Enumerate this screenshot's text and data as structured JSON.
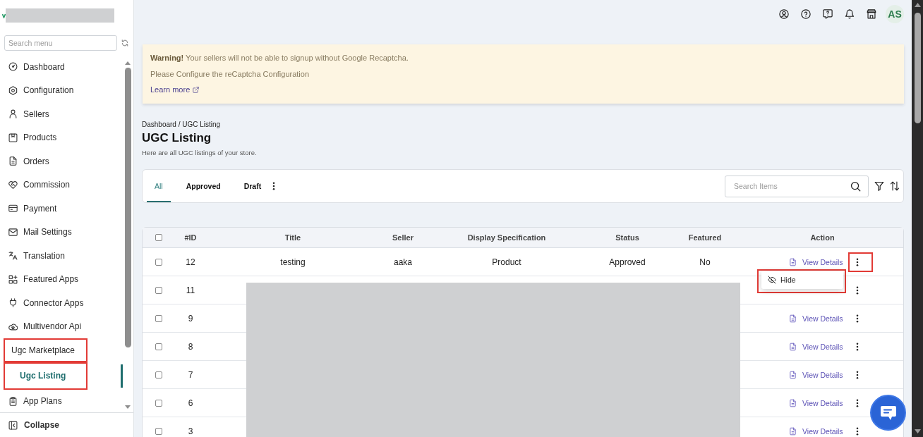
{
  "sidebar": {
    "search": {
      "placeholder": "Search menu"
    },
    "items": [
      {
        "label": "Dashboard",
        "selected": false,
        "highlighted": false
      },
      {
        "label": "Configuration",
        "selected": false,
        "highlighted": false
      },
      {
        "label": "Sellers",
        "selected": false,
        "highlighted": false
      },
      {
        "label": "Products",
        "selected": false,
        "highlighted": false
      },
      {
        "label": "Orders",
        "selected": false,
        "highlighted": false
      },
      {
        "label": "Commission",
        "selected": false,
        "highlighted": false
      },
      {
        "label": "Payment",
        "selected": false,
        "highlighted": false
      },
      {
        "label": "Mail Settings",
        "selected": false,
        "highlighted": false
      },
      {
        "label": "Translation",
        "selected": false,
        "highlighted": false
      },
      {
        "label": "Featured Apps",
        "selected": false,
        "highlighted": false
      },
      {
        "label": "Connector Apps",
        "selected": false,
        "highlighted": false
      },
      {
        "label": "Multivendor Api",
        "selected": false,
        "highlighted": false
      },
      {
        "label": "Ugc Marketplace",
        "selected": false,
        "highlighted": true,
        "children": [
          {
            "label": "Ugc Listing",
            "selected": true,
            "highlighted": true
          }
        ]
      },
      {
        "label": "App Plans",
        "selected": false,
        "highlighted": false
      }
    ],
    "collapse": {
      "label": "Collapse"
    }
  },
  "header": {
    "avatar": {
      "initials": "AS"
    }
  },
  "warning": {
    "message": "**Warning!** Your sellers will not be able to signup without Google Recaptcha.",
    "detail": "Please Configure the reCaptcha Configuration",
    "link": "Learn more"
  },
  "breadcrumb": "Dashboard / UGC Listing",
  "page": {
    "title": "UGC Listing",
    "subtitle": "Here are all UGC listings of your store."
  },
  "tabs": [
    {
      "label": "All",
      "selected": true
    },
    {
      "label": "Approved",
      "selected": false
    },
    {
      "label": "Draft",
      "selected": false
    }
  ],
  "search": {
    "placeholder": "Search Items"
  },
  "table": {
    "header_checked": false,
    "columns": [
      "#ID",
      "Title",
      "Seller",
      "Display Specification",
      "Status",
      "Featured",
      "Action"
    ],
    "rows": [
      {
        "checked": false,
        "id": "12",
        "title": "testing",
        "seller": "aaka",
        "display_specification": "Product",
        "status": "Approved",
        "featured": "No",
        "action": "View Details",
        "highlighted": true
      },
      {
        "checked": false,
        "id": "11",
        "highlighted": false
      },
      {
        "checked": false,
        "id": "9",
        "action": "View Details",
        "highlighted": false
      },
      {
        "checked": false,
        "id": "8",
        "action": "View Details",
        "highlighted": false
      },
      {
        "checked": false,
        "id": "7",
        "action": "View Details",
        "highlighted": false
      },
      {
        "checked": false,
        "id": "6",
        "action": "View Details",
        "highlighted": false
      },
      {
        "checked": false,
        "id": "3",
        "action": "View Details",
        "highlighted": false
      }
    ]
  },
  "row_menu": {
    "highlighted": true,
    "items": [
      {
        "label": "Hide"
      }
    ]
  }
}
